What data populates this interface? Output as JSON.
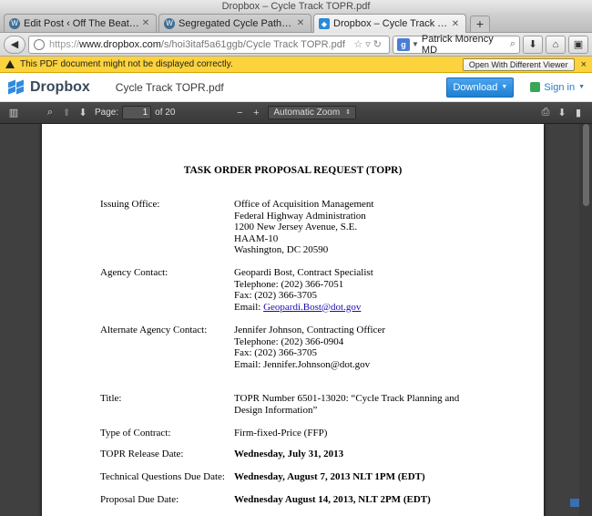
{
  "window": {
    "title": "Dropbox – Cycle Track TOPR.pdf"
  },
  "tabs": [
    {
      "label": "Edit Post ‹ Off The Beaten Path ...",
      "icon": "wordpress-icon",
      "active": false
    },
    {
      "label": "Segregated Cycle Paths: Who As...",
      "icon": "wordpress-icon",
      "active": false
    },
    {
      "label": "Dropbox – Cycle Track TOPR.pdf",
      "icon": "dropbox-icon",
      "active": true
    }
  ],
  "newtab_label": "+",
  "url": {
    "protocol": "https://",
    "host": "www.dropbox.com",
    "path": "/s/hoi3itaf5a61ggb/Cycle Track TOPR.pdf"
  },
  "search": {
    "engine_glyph": "g",
    "value": "Patrick Morency MD"
  },
  "warning": {
    "message": "This PDF document might not be displayed correctly.",
    "button": "Open With Different Viewer",
    "close": "×"
  },
  "dropbox": {
    "brand": "Dropbox",
    "filename": "Cycle Track TOPR.pdf",
    "download": "Download",
    "signin": "Sign in"
  },
  "pdf_toolbar": {
    "page_label": "Page:",
    "page_value": "1",
    "page_total": "of 20",
    "zoom": "Automatic Zoom"
  },
  "document": {
    "title": "TASK ORDER PROPOSAL REQUEST (TOPR)",
    "issuing": {
      "label": "Issuing Office:",
      "lines": [
        "Office of Acquisition Management",
        "Federal Highway Administration",
        "1200 New Jersey Avenue, S.E.",
        "HAAM-10",
        "Washington, DC 20590"
      ]
    },
    "agency": {
      "label": "Agency Contact:",
      "lines": [
        "Geopardi Bost, Contract Specialist",
        "Telephone: (202) 366-7051",
        "Fax: (202) 366-3705"
      ],
      "email_prefix": "Email: ",
      "email": "Geopardi.Bost@dot.gov"
    },
    "alternate": {
      "label": "Alternate Agency Contact:",
      "lines": [
        "Jennifer Johnson, Contracting Officer",
        "Telephone: (202) 366-0904",
        "Fax: (202) 366-3705",
        "Email: Jennifer.Johnson@dot.gov"
      ]
    },
    "title_row": {
      "label": "Title:",
      "lines": [
        "TOPR Number 6501-13020: “Cycle Track Planning and",
        "Design Information”"
      ]
    },
    "contract_type": {
      "label": "Type of Contract:",
      "value": "Firm-fixed-Price (FFP)"
    },
    "release": {
      "label": "TOPR Release Date:",
      "value": "Wednesday, July 31, 2013"
    },
    "questions": {
      "label": "Technical Questions Due Date:",
      "value": "Wednesday, August 7, 2013 NLT 1PM (EDT)"
    },
    "proposal": {
      "label": "Proposal Due Date:",
      "value": "Wednesday August 14, 2013, NLT 2PM (EDT)"
    }
  }
}
